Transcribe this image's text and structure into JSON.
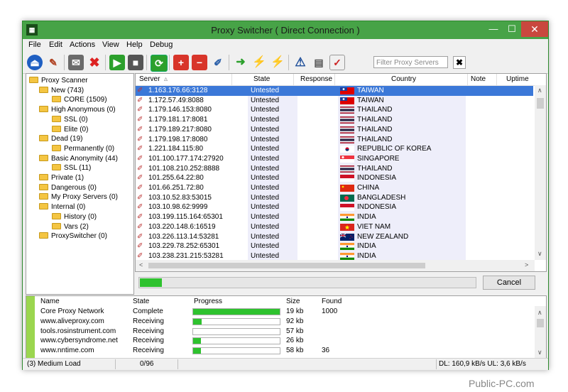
{
  "window": {
    "title": "Proxy Switcher ( Direct Connection )"
  },
  "titlebar": {
    "min": "—",
    "max": "☐",
    "close": "✕"
  },
  "menu": [
    "File",
    "Edit",
    "Actions",
    "View",
    "Help",
    "Debug"
  ],
  "toolbar": {
    "filter_placeholder": "Filter Proxy Servers",
    "clear": "✖"
  },
  "tree": [
    {
      "label": "Proxy Scanner",
      "level": 0
    },
    {
      "label": "New (743)",
      "level": 1
    },
    {
      "label": "CORE (1509)",
      "level": 2
    },
    {
      "label": "High Anonymous (0)",
      "level": 1
    },
    {
      "label": "SSL (0)",
      "level": 2
    },
    {
      "label": "Elite (0)",
      "level": 2
    },
    {
      "label": "Dead (19)",
      "level": 1
    },
    {
      "label": "Permanently (0)",
      "level": 2
    },
    {
      "label": "Basic Anonymity (44)",
      "level": 1
    },
    {
      "label": "SSL (11)",
      "level": 2
    },
    {
      "label": "Private (1)",
      "level": 1
    },
    {
      "label": "Dangerous (0)",
      "level": 1
    },
    {
      "label": "My Proxy Servers (0)",
      "level": 1
    },
    {
      "label": "Internal (0)",
      "level": 1
    },
    {
      "label": "History (0)",
      "level": 2
    },
    {
      "label": "Vars (2)",
      "level": 2
    },
    {
      "label": "ProxySwitcher (0)",
      "level": 1
    }
  ],
  "grid": {
    "headers": {
      "server": "Server",
      "sort": "▵",
      "state": "State",
      "response": "Response",
      "country": "Country",
      "note": "Note",
      "uptime": "Uptime"
    },
    "rows": [
      {
        "server": "1.163.176.66:3128",
        "state": "Untested",
        "country": "TAIWAN",
        "flag": "tw"
      },
      {
        "server": "1.172.57.49:8088",
        "state": "Untested",
        "country": "TAIWAN",
        "flag": "tw"
      },
      {
        "server": "1.179.146.153:8080",
        "state": "Untested",
        "country": "THAILAND",
        "flag": "th"
      },
      {
        "server": "1.179.181.17:8081",
        "state": "Untested",
        "country": "THAILAND",
        "flag": "th"
      },
      {
        "server": "1.179.189.217:8080",
        "state": "Untested",
        "country": "THAILAND",
        "flag": "th"
      },
      {
        "server": "1.179.198.17:8080",
        "state": "Untested",
        "country": "THAILAND",
        "flag": "th"
      },
      {
        "server": "1.221.184.115:80",
        "state": "Untested",
        "country": "REPUBLIC OF KOREA",
        "flag": "kr"
      },
      {
        "server": "101.100.177.174:27920",
        "state": "Untested",
        "country": "SINGAPORE",
        "flag": "sg"
      },
      {
        "server": "101.108.210.252:8888",
        "state": "Untested",
        "country": "THAILAND",
        "flag": "th"
      },
      {
        "server": "101.255.64.22:80",
        "state": "Untested",
        "country": "INDONESIA",
        "flag": "id"
      },
      {
        "server": "101.66.251.72:80",
        "state": "Untested",
        "country": "CHINA",
        "flag": "cn"
      },
      {
        "server": "103.10.52.83:53015",
        "state": "Untested",
        "country": "BANGLADESH",
        "flag": "bd"
      },
      {
        "server": "103.10.98.62:9999",
        "state": "Untested",
        "country": "INDONESIA",
        "flag": "id"
      },
      {
        "server": "103.199.115.164:65301",
        "state": "Untested",
        "country": "INDIA",
        "flag": "in"
      },
      {
        "server": "103.220.148.6:16519",
        "state": "Untested",
        "country": "VIET NAM",
        "flag": "vn"
      },
      {
        "server": "103.226.113.14:53281",
        "state": "Untested",
        "country": "NEW ZEALAND",
        "flag": "nz"
      },
      {
        "server": "103.229.78.252:65301",
        "state": "Untested",
        "country": "INDIA",
        "flag": "in"
      },
      {
        "server": "103.238.231.215:53281",
        "state": "Untested",
        "country": "INDIA",
        "flag": "in"
      }
    ]
  },
  "scan": {
    "progress_fraction": 0.065,
    "cancel_label": "Cancel"
  },
  "downloads": {
    "headers": {
      "name": "Name",
      "state": "State",
      "progress": "Progress",
      "size": "Size",
      "found": "Found"
    },
    "rows": [
      {
        "name": "Core Proxy Network",
        "state": "Complete",
        "progress": 1.0,
        "size": "19 kb",
        "found": "1000"
      },
      {
        "name": "www.aliveproxy.com",
        "state": "Receiving",
        "progress": 0.1,
        "size": "92 kb",
        "found": ""
      },
      {
        "name": "tools.rosinstrument.com",
        "state": "Receiving",
        "progress": 0.0,
        "size": "57 kb",
        "found": ""
      },
      {
        "name": "www.cybersyndrome.net",
        "state": "Receiving",
        "progress": 0.09,
        "size": "26 kb",
        "found": ""
      },
      {
        "name": "www.nntime.com",
        "state": "Receiving",
        "progress": 0.09,
        "size": "58 kb",
        "found": "36"
      }
    ]
  },
  "status": {
    "load": "(3) Medium Load",
    "count": "0/96",
    "speed": "DL: 160,9 kB/s UL: 3,6 kB/s"
  },
  "watermark": "Public-PC.com",
  "colors": {
    "titlebar": "#47a347",
    "selection": "#3b78d8",
    "progress": "#2ec22e"
  }
}
